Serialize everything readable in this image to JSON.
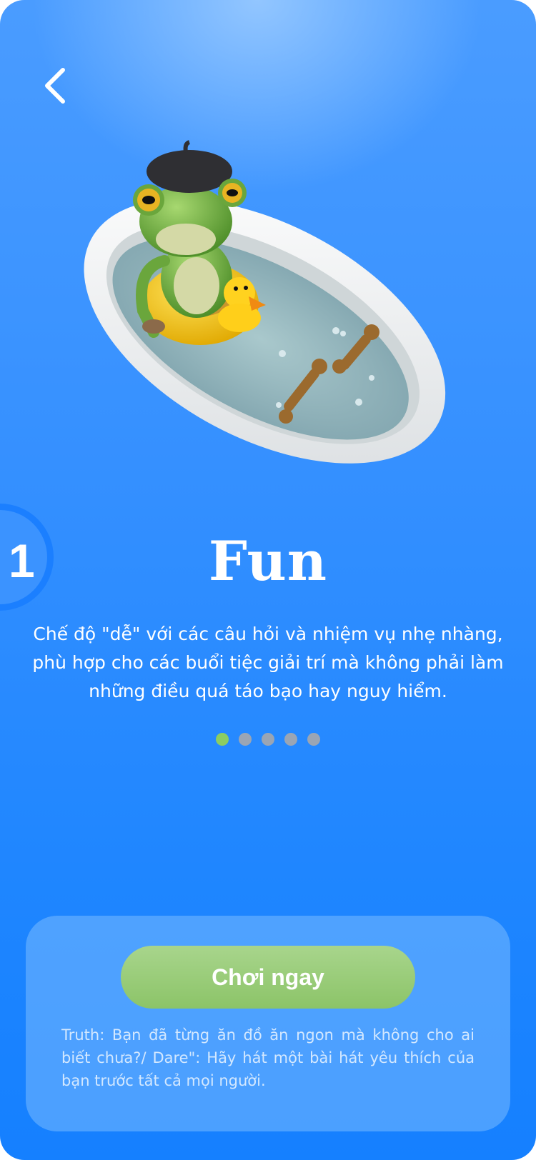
{
  "mode": {
    "step_number": "1",
    "title": "Fun",
    "description": "Chế độ \"dễ\" với các câu hỏi và nhiệm vụ nhẹ nhàng, phù hợp cho các buổi tiệc giải trí mà không phải làm những điều quá táo bạo hay nguy hiểm."
  },
  "pagination": {
    "total": 5,
    "active_index": 0
  },
  "actions": {
    "play_label": "Chơi ngay",
    "hint": "Truth: Bạn đã từng ăn đồ ăn ngon mà không cho ai biết chưa?/ Dare\": Hãy hát một bài hát yêu thích của bạn trước tất cả mọi người."
  },
  "icons": {
    "back": "chevron-left-icon",
    "hero": "frog-in-bathtub-illustration"
  },
  "colors": {
    "background_top": "#4a9cff",
    "background_bottom": "#1580ff",
    "play_button": "#8cc468",
    "dot_active": "#8ccd61",
    "dot_inactive": "#9aa5b4"
  }
}
